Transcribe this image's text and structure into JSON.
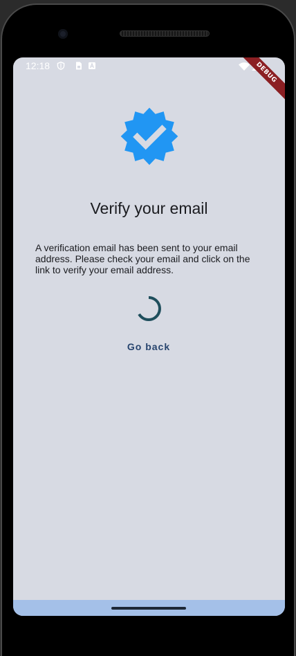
{
  "status_bar": {
    "time": "12:18",
    "icons": [
      "shield-icon",
      "sim-card-icon",
      "font-a-icon",
      "wifi-icon",
      "signal-icon"
    ]
  },
  "debug_banner": "DEBUG",
  "page": {
    "badge_icon": "verified-badge-icon",
    "title": "Verify your email",
    "message": "A verification email has been sent to your email address. Please check your email and click on the link to verify your email address.",
    "go_back_label": "Go back"
  },
  "colors": {
    "background": "#d7dae3",
    "badge": "#2196f3",
    "spinner": "#1e4e5c",
    "button_text": "#27446e",
    "nav_bar": "#a4c0e8",
    "debug_banner": "#8b1f23"
  }
}
